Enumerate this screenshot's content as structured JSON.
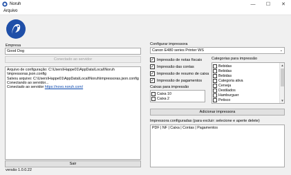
{
  "window": {
    "title": "Noruh",
    "minimize": "—",
    "maximize": "☐",
    "close": "✕"
  },
  "menu": {
    "file": "Arquivo"
  },
  "company": {
    "label": "Empresa",
    "value": "Good Dog",
    "connect_button": "Conectado ao servidor"
  },
  "log": {
    "lines": [
      "Arquivo de configuração: C:\\Users\\Happe01\\AppData\\Local\\Noruh",
      "\\impressoras.json.config",
      "Salvou arquivo: C:\\Users\\Happe01\\AppData\\Local\\Noruh\\impressoras.json.config",
      "Conectando ao servidor...",
      "Conectado ao servidor "
    ],
    "link": "https://novo.noruh.com/"
  },
  "exit_button": "Sair",
  "version": "versão 1.0.0.22",
  "printer": {
    "label": "Configurar impressora",
    "selected": "Canon E480 series Printer WS",
    "arrow": "⌄",
    "options": [
      {
        "label": "Impressão de notas fiscais",
        "checked": true
      },
      {
        "label": "Impressão das contas",
        "checked": true
      },
      {
        "label": "Impressão de resumo de caixa",
        "checked": true
      },
      {
        "label": "Impressão de pagamentos",
        "checked": true
      }
    ],
    "check_mark": "✓"
  },
  "cash_boxes": {
    "label": "Caixas para impressão",
    "items": [
      {
        "label": "Caixa 10",
        "checked": false
      },
      {
        "label": "Caixa 2",
        "checked": false
      }
    ]
  },
  "categories": {
    "label": "Categorias para impressão",
    "items": [
      {
        "label": "Bebidas",
        "checked": false
      },
      {
        "label": "Bebidas",
        "checked": false
      },
      {
        "label": "Bebidas",
        "checked": false
      },
      {
        "label": "Categoria ativa",
        "checked": false
      },
      {
        "label": "Cerveja",
        "checked": false
      },
      {
        "label": "Destilados",
        "checked": false
      },
      {
        "label": "Hamburguer",
        "checked": false
      },
      {
        "label": "Petisco",
        "checked": false
      }
    ]
  },
  "add_printer_button": "Adicionar impressora",
  "configured": {
    "label": "Impressora configuradas (para excluir: selecione e aperte delete)",
    "items": [
      "PDF | NF | Caixa | Contas | Pagamentos"
    ]
  },
  "colors": {
    "link": "#0645ad",
    "logo_blue": "#1f4fa8"
  }
}
